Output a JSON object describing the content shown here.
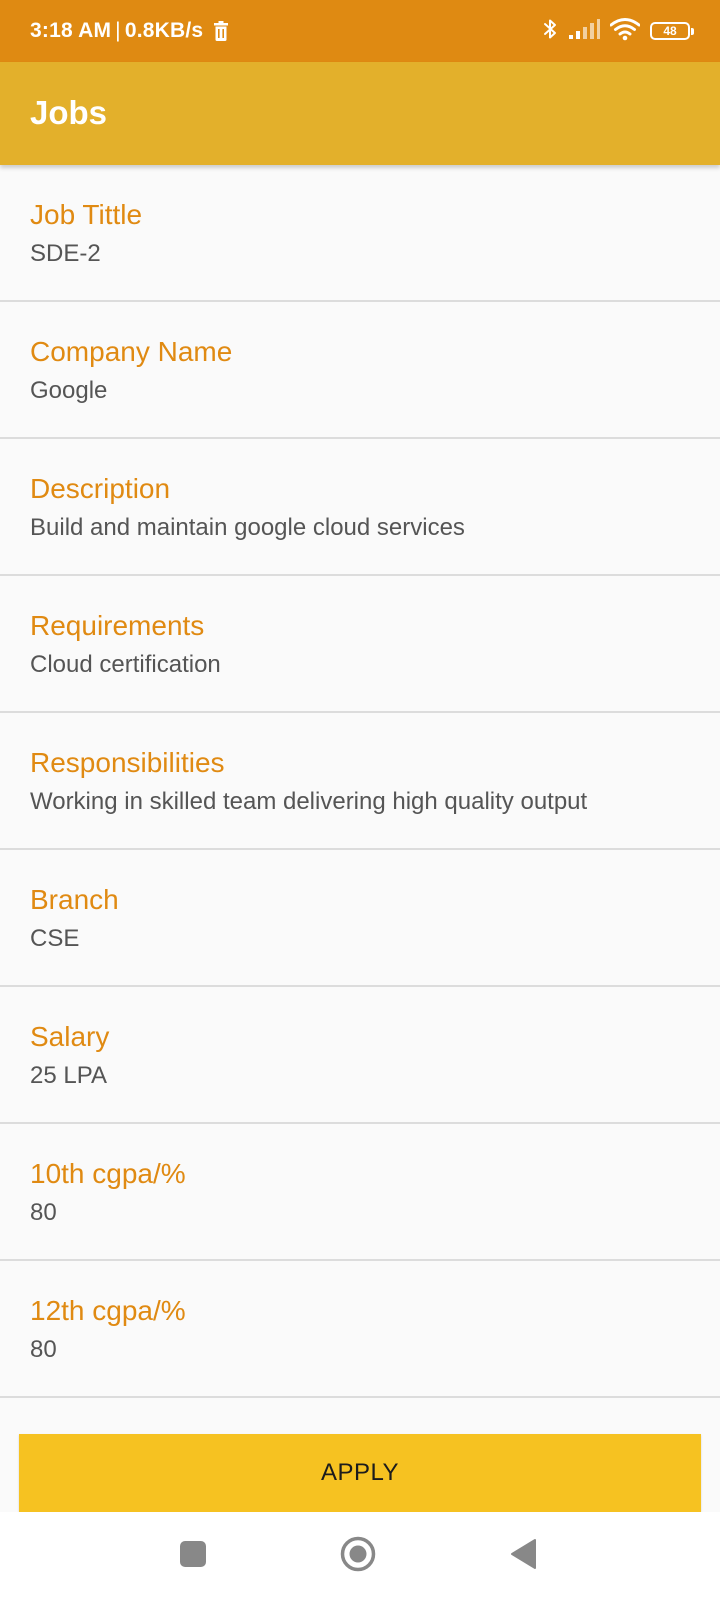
{
  "status_bar": {
    "time": "3:18 AM",
    "separator": "|",
    "network_speed": "0.8KB/s",
    "battery_level": "48",
    "icons": [
      "trash-icon",
      "bluetooth-icon",
      "signal-icon",
      "wifi-icon",
      "battery-icon"
    ]
  },
  "app_bar": {
    "title": "Jobs"
  },
  "details": [
    {
      "label": "Job Tittle",
      "value": "SDE-2"
    },
    {
      "label": "Company Name",
      "value": "Google"
    },
    {
      "label": "Description",
      "value": "Build and maintain google cloud services"
    },
    {
      "label": "Requirements",
      "value": "Cloud certification"
    },
    {
      "label": "Responsibilities",
      "value": "Working in skilled team delivering high quality output"
    },
    {
      "label": "Branch",
      "value": "CSE"
    },
    {
      "label": "Salary",
      "value": "25 LPA"
    },
    {
      "label": "10th cgpa/%",
      "value": "80"
    },
    {
      "label": "12th cgpa/%",
      "value": "80"
    }
  ],
  "apply_button": {
    "label": "APPLY"
  },
  "nav_bar": {
    "icons": [
      "recents-square-icon",
      "home-circle-icon",
      "back-triangle-icon"
    ]
  },
  "colors": {
    "status_bar": "#df8a12",
    "app_bar": "#e3b02b",
    "label": "#e08a12",
    "value": "#555555",
    "button": "#f6c221",
    "background": "#fafafa"
  }
}
